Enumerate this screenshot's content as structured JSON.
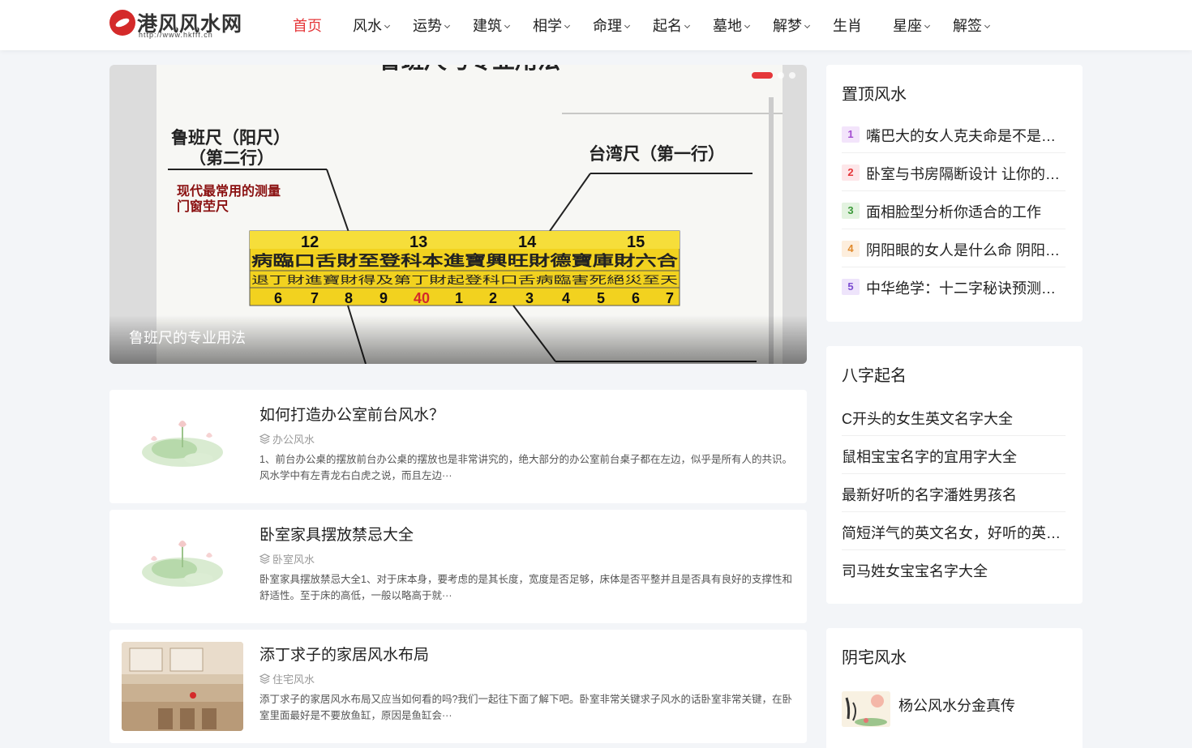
{
  "header": {
    "logo_text": "港风风水网",
    "logo_url": "http://www.hkfff.cn",
    "nav": [
      {
        "label": "首页",
        "active": true,
        "has_dropdown": false
      },
      {
        "label": "风水",
        "has_dropdown": true
      },
      {
        "label": "运势",
        "has_dropdown": true
      },
      {
        "label": "建筑",
        "has_dropdown": true
      },
      {
        "label": "相学",
        "has_dropdown": true
      },
      {
        "label": "命理",
        "has_dropdown": true
      },
      {
        "label": "起名",
        "has_dropdown": true
      },
      {
        "label": "墓地",
        "has_dropdown": true
      },
      {
        "label": "解梦",
        "has_dropdown": true
      },
      {
        "label": "生肖",
        "has_dropdown": false
      },
      {
        "label": "星座",
        "has_dropdown": true
      },
      {
        "label": "解签",
        "has_dropdown": true
      }
    ]
  },
  "slider": {
    "caption": "鲁班尺的专业用法",
    "image": {
      "heading": "鲁班尺与专业用法",
      "label_left_1": "鲁班尺（阳尺）",
      "label_left_2": "（第二行）",
      "label_left_3": "现代最常用的测量",
      "label_left_4": "门窗茔尺",
      "label_right": "台湾尺（第一行）",
      "ruler_top_row": "病臨口舌財至登科本進寶興旺財德寶庫財六合",
      "ruler_mid_row": "退丁財進寶財得及第丁財起登科口舌病臨害死絕災至天",
      "ruler_numbers_big": [
        "12",
        "13",
        "14",
        "15"
      ],
      "ruler_numbers_small": [
        "6",
        "7",
        "8",
        "9",
        "40",
        "1",
        "2",
        "3",
        "4",
        "5",
        "6",
        "7"
      ]
    },
    "dots": 3,
    "active_dot": 0
  },
  "articles": [
    {
      "title": "如何打造办公室前台风水？",
      "category": "办公风水",
      "desc": "1、前台办公桌的摆放前台办公桌的摆放也是非常讲究的，绝大部分的办公室前台桌子都在左边，似乎是所有人的共识。风水学中有左青龙右白虎之说，而且左边···",
      "thumb": "lotus"
    },
    {
      "title": "卧室家具摆放禁忌大全",
      "category": "卧室风水",
      "desc": "卧室家具摆放禁忌大全1、对于床本身，要考虑的是其长度，宽度是否足够，床体是否平整并且是否具有良好的支撑性和舒适性。至于床的高低，一般以略高于就···",
      "thumb": "lotus"
    },
    {
      "title": "添丁求子的家居风水布局",
      "category": "住宅风水",
      "desc": "添丁求子的家居风水布局又应当如何看的吗?我们一起往下面了解下吧。卧室非常关键求子风水的话卧室非常关键，在卧室里面最好是不要放鱼缸，原因是鱼缸会···",
      "thumb": "kitchen"
    }
  ],
  "sidebar": {
    "top_feng_shui": {
      "title": "置顶风水",
      "items": [
        {
          "rank": "1",
          "text": "嘴巴大的女人克夫命是不是真的"
        },
        {
          "rank": "2",
          "text": "卧室与书房隔断设计 让你的卧室与书房更好"
        },
        {
          "rank": "3",
          "text": "面相脸型分析你适合的工作"
        },
        {
          "rank": "4",
          "text": "阴阳眼的女人是什么命 阴阳眼的女人命运"
        },
        {
          "rank": "5",
          "text": "中华绝学：十二字秘诀预测吉凶"
        }
      ],
      "rank_colors": [
        {
          "bg": "#f3e4fb",
          "fg": "#a34bd1"
        },
        {
          "bg": "#fde6e9",
          "fg": "#e5373a"
        },
        {
          "bg": "#e3f3e0",
          "fg": "#3c9a3a"
        },
        {
          "bg": "#fdeedd",
          "fg": "#e08a2c"
        },
        {
          "bg": "#eee4fb",
          "fg": "#7b4bd1"
        }
      ]
    },
    "bazi_naming": {
      "title": "八字起名",
      "items": [
        "C开头的女生英文名字大全",
        "鼠相宝宝名字的宜用字大全",
        "最新好听的名字潘姓男孩名",
        "简短洋气的英文名女，好听的英文名字",
        "司马姓女宝宝名字大全"
      ]
    },
    "yin_zhai": {
      "title": "阴宅风水",
      "items": [
        {
          "text": "杨公风水分金真传",
          "thumb": "fengshui-art"
        }
      ]
    }
  }
}
